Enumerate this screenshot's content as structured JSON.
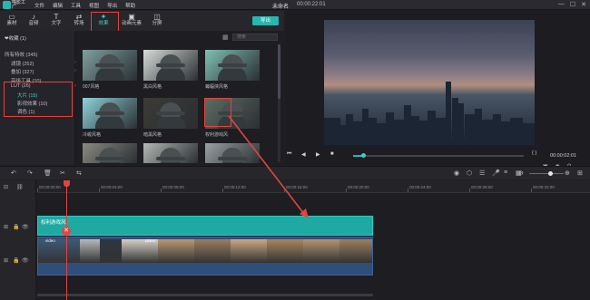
{
  "app": {
    "logo_text": "喵影工厂",
    "menu": [
      "文件",
      "编辑",
      "工具",
      "视图",
      "导出",
      "帮助"
    ],
    "title": "未命名",
    "title_time": "00:00:22:01",
    "window_controls": [
      "—",
      "☐",
      "✕"
    ]
  },
  "toolbar": {
    "items": [
      {
        "icon": "folder-icon",
        "glyph": "▭",
        "label": "素材"
      },
      {
        "icon": "music-note-icon",
        "glyph": "♪",
        "label": "音频"
      },
      {
        "icon": "text-icon",
        "glyph": "T",
        "label": "文字"
      },
      {
        "icon": "transition-icon",
        "glyph": "⇄",
        "label": "转场"
      },
      {
        "icon": "effects-icon",
        "glyph": "✦",
        "label": "效果"
      },
      {
        "icon": "animated-elements-icon",
        "glyph": "▣",
        "label": "动画元素"
      },
      {
        "icon": "split-screen-icon",
        "glyph": "◫",
        "label": "分屏"
      }
    ],
    "active_label": "效果",
    "export_label": "导出"
  },
  "left_panel": {
    "favorites": "❤收藏 (1)",
    "categories": [
      {
        "label": "所有特效 (345)",
        "indent": 0,
        "arrow": false,
        "selected": false
      },
      {
        "label": "滤镜 (252)",
        "indent": 1,
        "arrow": true,
        "selected": false
      },
      {
        "label": "叠加 (327)",
        "indent": 1,
        "arrow": true,
        "selected": false
      },
      {
        "label": "高级工具 (10)",
        "indent": 1,
        "arrow": false,
        "selected": false
      },
      {
        "label": "LUT (26)",
        "indent": 1,
        "arrow": true,
        "selected": false
      },
      {
        "label": "大片 (15)",
        "indent": 2,
        "arrow": false,
        "selected": true
      },
      {
        "label": "影视效果 (10)",
        "indent": 2,
        "arrow": false,
        "selected": false
      },
      {
        "label": "调色 (1)",
        "indent": 2,
        "arrow": false,
        "selected": false
      }
    ]
  },
  "effects_grid": {
    "search_placeholder": "搜索",
    "items": [
      {
        "label": "007风格",
        "tint": "#7ea0a0"
      },
      {
        "label": "黑白风格",
        "tint": "#d8dcd8"
      },
      {
        "label": "蝙蝠侠风格",
        "tint": "#7fc0b4"
      },
      {
        "label": "冷峻风格",
        "tint": "#8fd2da"
      },
      {
        "label": "暗黑风格",
        "tint": "#3c3a34"
      },
      {
        "label": "权利游戏风",
        "tint": "#5e6c63"
      },
      {
        "label": "",
        "tint": "#8a8a80"
      },
      {
        "label": "",
        "tint": "#b5b8b4"
      },
      {
        "label": "",
        "tint": "#9aa2a4"
      }
    ]
  },
  "preview": {
    "controls": [
      "⏮",
      "◀",
      "▶",
      "■"
    ],
    "progress": 0.06,
    "brackets": "{  }",
    "timecode": "00:00:02:01",
    "right_icons": [
      "▣",
      "◉",
      "⚲"
    ]
  },
  "timeline_toolbar": {
    "left_icons": [
      "↶",
      "↷",
      "🗑",
      "✂",
      "⇆"
    ],
    "right_icons": [
      "◉",
      "⬡",
      "☰",
      "🎤",
      "≡",
      "▦",
      "⊖",
      "⊕",
      "⊞"
    ]
  },
  "timeline": {
    "ruler": [
      "00:00:00:00",
      "00:00:04:00",
      "00:00:08:00",
      "00:00:12:00",
      "00:00:16:00",
      "00:00:20:00",
      "00:00:24:00",
      "00:00:28:00",
      "00:00:32:00"
    ],
    "fx_track_label": "权利游戏风",
    "video_labels": [
      "video",
      "piano"
    ],
    "track_icons": [
      "⊞",
      "🔒",
      "👁"
    ]
  }
}
